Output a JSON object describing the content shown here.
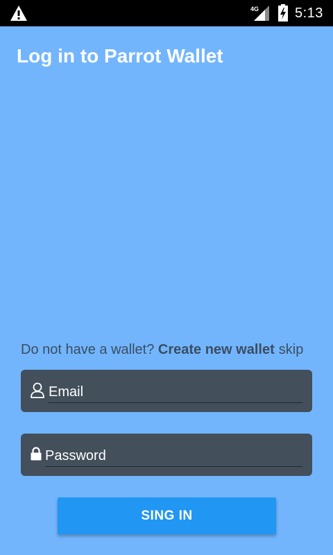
{
  "status_bar": {
    "time": "5:13",
    "network_label": "4G",
    "icons": [
      "warning-icon",
      "signal-icon",
      "battery-charging-icon"
    ]
  },
  "header": {
    "title": "Log in to Parrot Wallet"
  },
  "signup": {
    "prompt": "Do not have a wallet? ",
    "create_link": "Create new wallet",
    "skip_link": "skip"
  },
  "form": {
    "email_placeholder": "Email",
    "email_icon": "user-icon",
    "password_placeholder": "Password",
    "password_icon": "lock-icon",
    "submit_label": "SING IN"
  },
  "colors": {
    "background": "#72b5fd",
    "field_background": "#434f5b",
    "button": "#2196f3",
    "status_bar": "#000000"
  }
}
